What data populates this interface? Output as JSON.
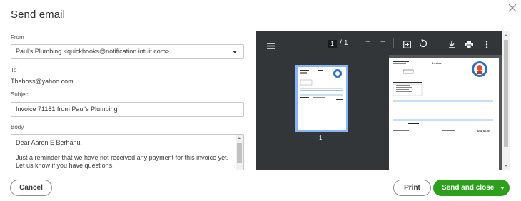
{
  "dialog": {
    "title": "Send email",
    "close_icon": "close-icon"
  },
  "form": {
    "from_label": "From",
    "from_value": "Paul's Plumbing <quickbooks@notification.intuit.com>",
    "to_label": "To",
    "to_value": "Theboss@yahoo.com",
    "subject_label": "Subject",
    "subject_value": "Invoice 71181 from Paul's Plumbing",
    "body_label": "Body",
    "body_lines": [
      "Dear Aaron E Berhanu,",
      "Just a reminder that we have not received any payment for this invoice yet.",
      "Let us know if you have questions."
    ]
  },
  "viewer": {
    "menu_icon": "menu-icon",
    "current_page": "1",
    "page_sep": "/",
    "total_pages": "1",
    "zoom_out": "−",
    "zoom_in": "+",
    "fit_icon": "fit-page-icon",
    "rotate_icon": "rotate-icon",
    "download_icon": "download-icon",
    "print_icon": "print-icon",
    "more_icon": "more-vert-icon",
    "thumbnail_label": "1",
    "invoice_heading": "Invoice",
    "total_amount": "USD 66.00"
  },
  "actions": {
    "cancel": "Cancel",
    "print": "Print",
    "send": "Send and close"
  },
  "colors": {
    "primary_green": "#2ca01c",
    "viewer_dark": "#323639",
    "viewer_bg": "#525659",
    "thumb_highlight": "#8ab4f8"
  }
}
